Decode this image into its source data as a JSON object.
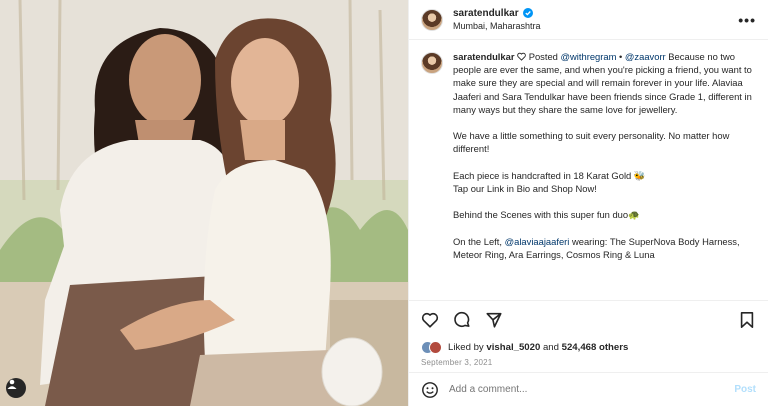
{
  "header": {
    "username": "saratendulkar",
    "location": "Mumbai, Maharashtra",
    "more_label": "•••"
  },
  "caption": {
    "username": "saratendulkar",
    "posted_prefix": " Posted ",
    "mention1": "@withregram",
    "bullet": " • ",
    "mention2": "@zaavorr",
    "para1": " Because no two people are ever the same, and when you're picking a friend, you want to make sure they are special and will remain forever in your life. Alaviaa Jaaferi and Sara Tendulkar have been friends since Grade 1, different in many ways but they share the same love for jewellery.",
    "para2": "We have a little something to suit every personality. No matter how different!",
    "para3": "Each piece is handcrafted in 18 Karat Gold 🐝",
    "para4": "Tap our Link in Bio and Shop Now!",
    "para5": "Behind the Scenes with this super fun duo🐢",
    "para6_prefix": "On the Left, ",
    "para6_mention": "@alaviaajaaferi",
    "para6_rest": " wearing: The SuperNova Body Harness, Meteor Ring, Ara Earrings, Cosmos Ring & Luna"
  },
  "likes": {
    "liked_by": "Liked by ",
    "user": "vishal_5020",
    "and": " and ",
    "count": "524,468 others"
  },
  "date": "September 3, 2021",
  "comment": {
    "placeholder": "Add a comment...",
    "post_label": "Post"
  },
  "colors": {
    "verified": "#0095f6",
    "link": "#00376b",
    "post_disabled": "#b2dffc"
  },
  "icons": {
    "like": "heart-icon",
    "comment": "comment-icon",
    "share": "paper-plane-icon",
    "save": "bookmark-icon",
    "emoji": "smiley-icon",
    "tags": "person-tag-icon"
  }
}
